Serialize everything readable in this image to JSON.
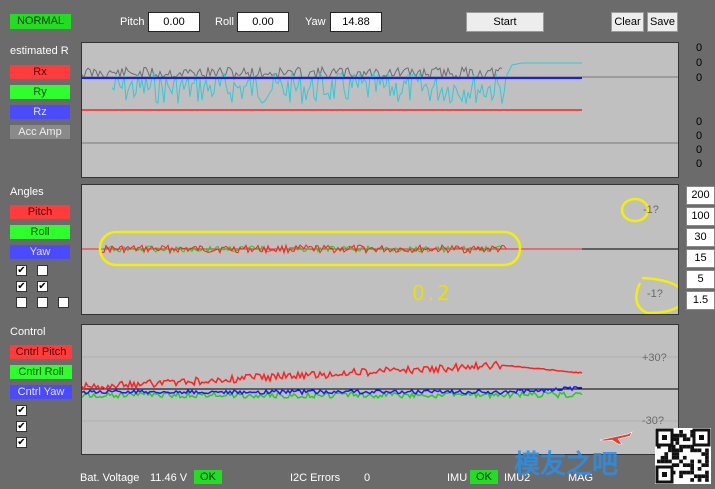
{
  "header": {
    "mode_badge": "NORMAL",
    "pitch_label": "Pitch",
    "pitch_value": "0.00",
    "roll_label": "Roll",
    "roll_value": "0.00",
    "yaw_label": "Yaw",
    "yaw_value": "14.88",
    "start_label": "Start",
    "clear_label": "Clear",
    "save_label": "Save"
  },
  "estimated": {
    "title": "estimated R",
    "items": [
      "Rx",
      "Ry",
      "Rz",
      "Acc Amp"
    ],
    "right_values": [
      "0",
      "0",
      "0",
      "0",
      "0",
      "0",
      "0"
    ]
  },
  "angles": {
    "title": "Angles",
    "items": [
      "Pitch",
      "Roll",
      "Yaw"
    ],
    "top_label": "-1?",
    "bottom_label": "-1?",
    "scales": [
      "200",
      "100",
      "30",
      "15",
      "5",
      "1.5"
    ],
    "annotation": "0.2"
  },
  "control": {
    "title": "Control",
    "items": [
      "Cntrl Pitch",
      "Cntrl Roll",
      "Cntrl Yaw"
    ],
    "top_label": "+30?",
    "bottom_label": "-30?"
  },
  "footer": {
    "bat_label": "Bat. Voltage",
    "bat_value": "11.46 V",
    "bat_status": "OK",
    "i2c_label": "I2C Errors",
    "i2c_value": "0",
    "imu_label": "IMU",
    "imu_status": "OK",
    "imu2_text": "IMU2",
    "mag_text": "MAG",
    "watermark_text": "模友之吧"
  },
  "colors": {
    "red": "#ff3b3b",
    "green": "#2dff2d",
    "blue": "#4a4aff",
    "gray": "#8a8a8a",
    "cyan": "#33c8d8",
    "highlight": "#f4f000"
  }
}
